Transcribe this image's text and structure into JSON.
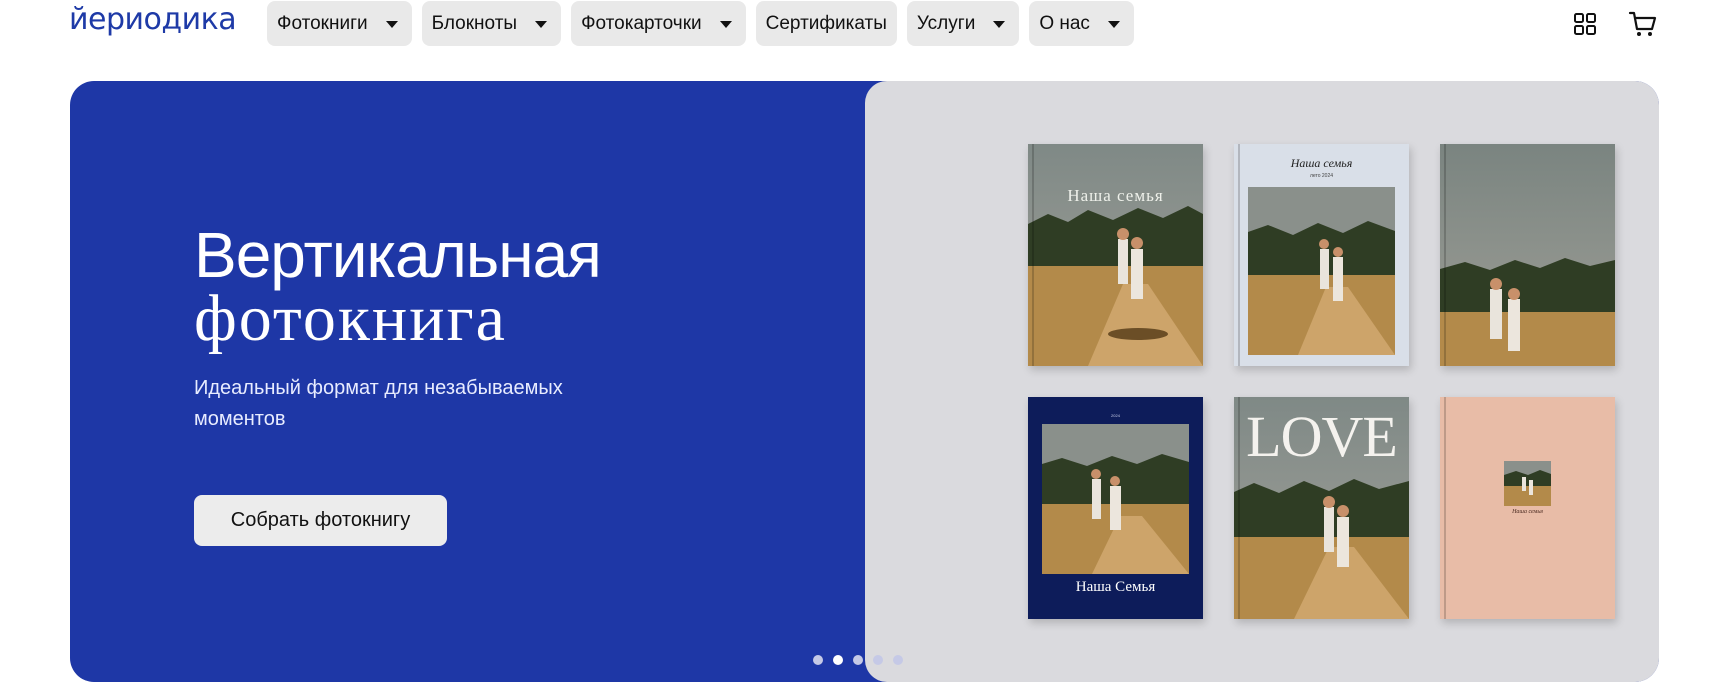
{
  "header": {
    "logo": "йериодика",
    "nav": [
      {
        "label": "Фотокниги",
        "has_dropdown": true
      },
      {
        "label": "Блокноты",
        "has_dropdown": true
      },
      {
        "label": "Фотокарточки",
        "has_dropdown": true
      },
      {
        "label": "Сертификаты",
        "has_dropdown": false
      },
      {
        "label": "Услуги",
        "has_dropdown": true
      },
      {
        "label": "О нас",
        "has_dropdown": true
      }
    ],
    "icons": [
      "grid-icon",
      "cart-icon"
    ]
  },
  "hero": {
    "title_line1": "Вертикальная",
    "title_line2": "фотокнига",
    "subtitle": "Идеальный формат для незабываемых моментов",
    "cta_label": "Собрать фотокнигу",
    "colors": {
      "left_bg": "#1e37a6",
      "right_bg": "#dadade"
    },
    "slides_total": 5,
    "active_slide": 2
  },
  "books": [
    {
      "title": "Наша семья",
      "subtitle": ""
    },
    {
      "title": "Наша семья",
      "subtitle": "лето 2024"
    },
    {
      "title": "",
      "subtitle": ""
    },
    {
      "title": "Наша Семья",
      "subtitle": "2024"
    },
    {
      "title": "LOVE",
      "subtitle": ""
    },
    {
      "title": "Наша семья",
      "subtitle": ""
    }
  ]
}
